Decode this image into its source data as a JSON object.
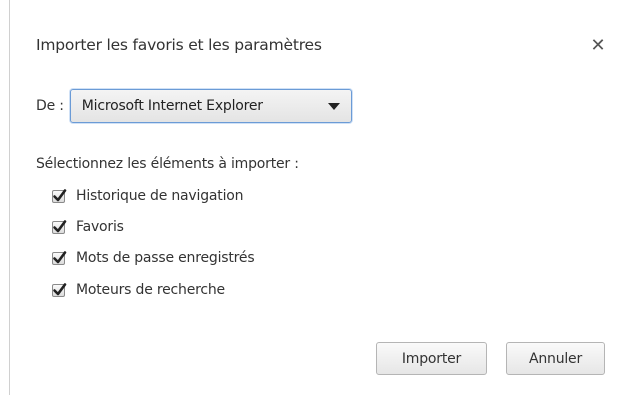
{
  "dialog": {
    "title": "Importer les favoris et les paramètres",
    "close_icon": "close-icon"
  },
  "source": {
    "label": "De :",
    "selected": "Microsoft Internet Explorer"
  },
  "items_section": {
    "label": "Sélectionnez les éléments à importer :",
    "items": [
      {
        "label": "Historique de navigation",
        "checked": true
      },
      {
        "label": "Favoris",
        "checked": true
      },
      {
        "label": "Mots de passe enregistrés",
        "checked": true
      },
      {
        "label": "Moteurs de recherche",
        "checked": true
      }
    ]
  },
  "buttons": {
    "import_label": "Importer",
    "cancel_label": "Annuler"
  }
}
